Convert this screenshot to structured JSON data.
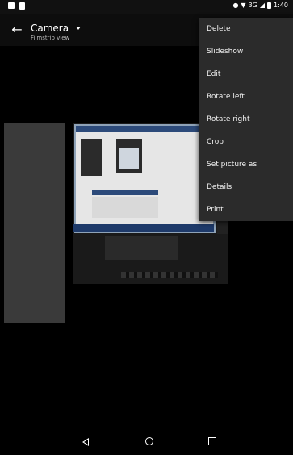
{
  "status_bar": {
    "time": "1:40",
    "network": "3G",
    "left_icons": [
      "lock-icon",
      "notification-icon"
    ],
    "right_icons": [
      "location-icon",
      "wifi-icon",
      "signal-icon",
      "battery-icon"
    ]
  },
  "app_bar": {
    "title": "Camera",
    "subtitle": "Filmstrip view",
    "back_icon": "arrow-back-icon",
    "dropdown_icon": "dropdown-arrow-icon"
  },
  "menu": {
    "items": [
      {
        "label": "Delete"
      },
      {
        "label": "Slideshow"
      },
      {
        "label": "Edit"
      },
      {
        "label": "Rotate left"
      },
      {
        "label": "Rotate right"
      },
      {
        "label": "Crop"
      },
      {
        "label": "Set picture as"
      },
      {
        "label": "Details"
      },
      {
        "label": "Print"
      }
    ]
  },
  "nav_bar": {
    "buttons": [
      "back-icon",
      "home-icon",
      "recents-icon"
    ]
  }
}
